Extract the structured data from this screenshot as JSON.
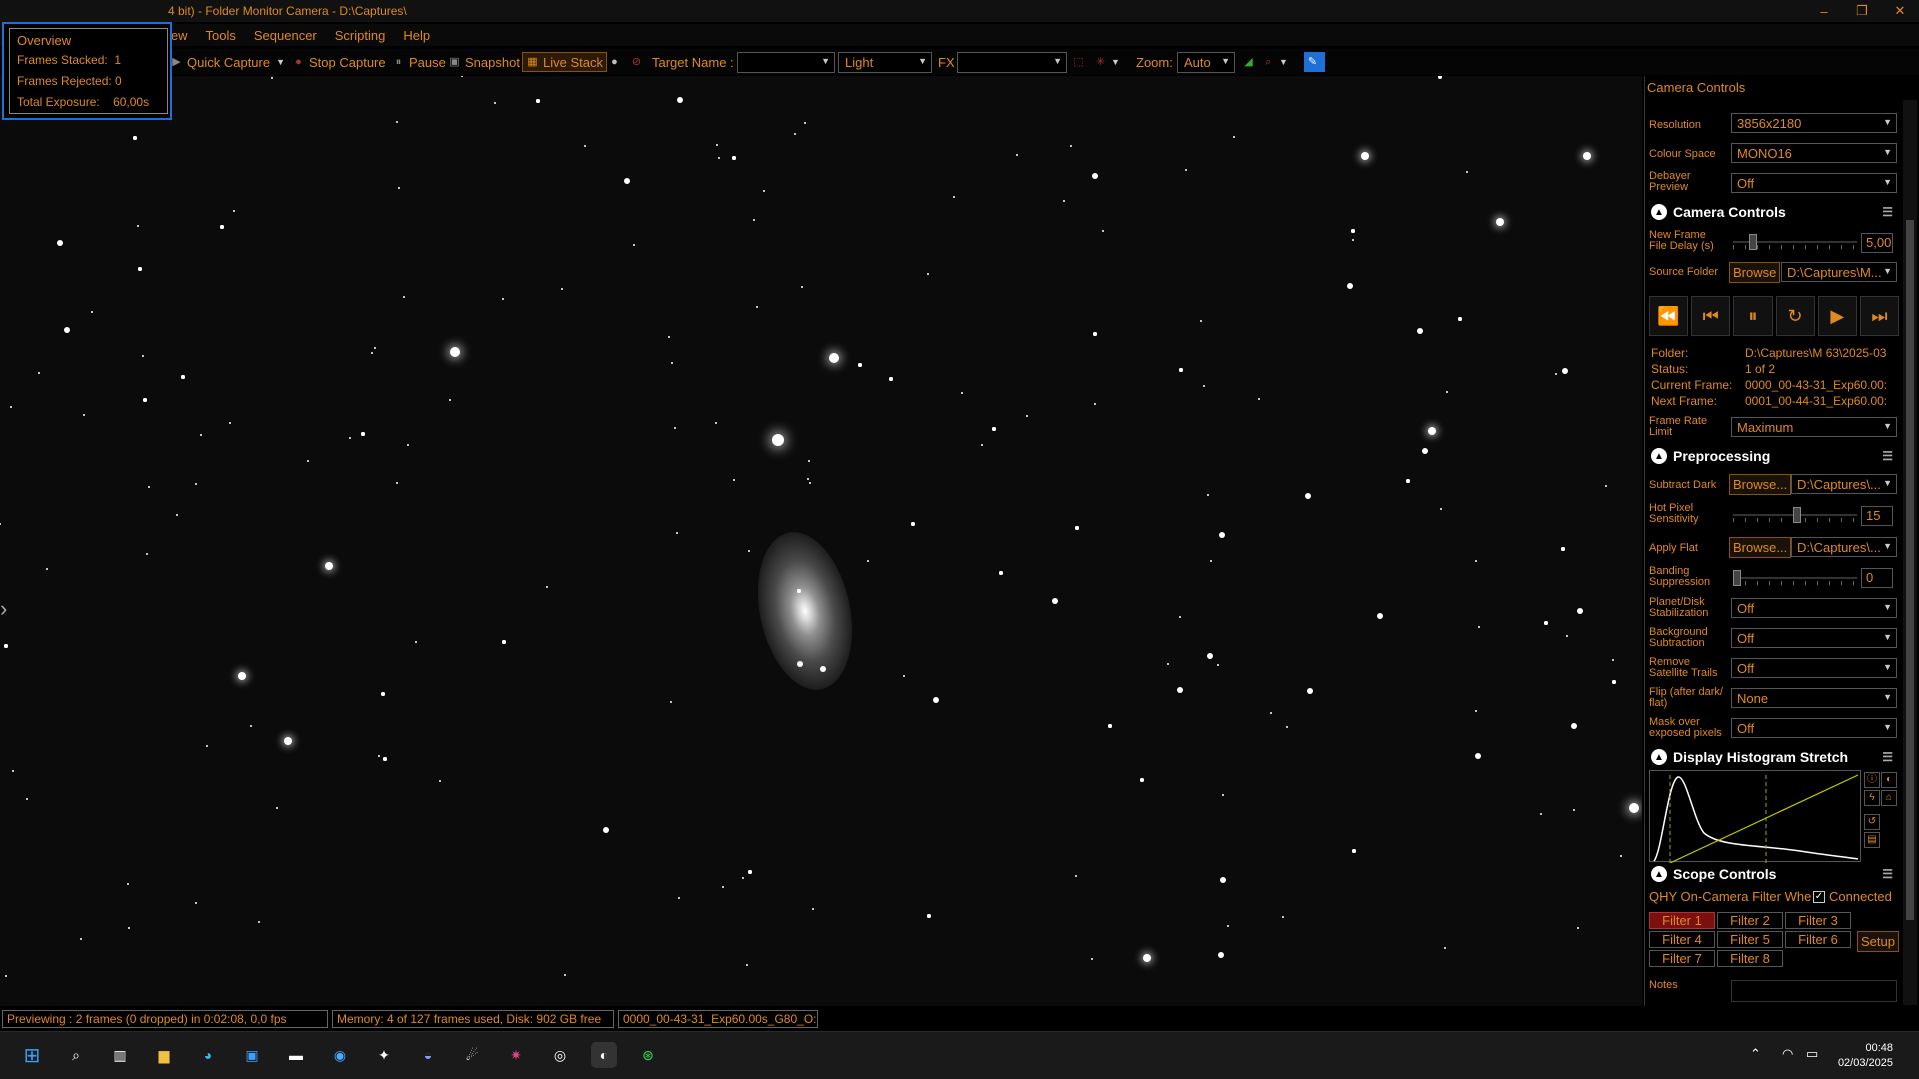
{
  "window": {
    "title": "4 bit) - Folder Monitor Camera - D:\\Captures\\",
    "controls": [
      "–",
      "❐",
      "✕"
    ]
  },
  "menu": [
    "iew",
    "Tools",
    "Sequencer",
    "Scripting",
    "Help"
  ],
  "toolbar": {
    "quick_capture": "Quick Capture",
    "stop_capture": "Stop Capture",
    "pause": "Pause",
    "snapshot": "Snapshot",
    "live_stack": "Live Stack",
    "target_name_label": "Target Name :",
    "target_name_value": "",
    "frame_type": "Light",
    "fx_label": "FX",
    "fx_value": "",
    "zoom_label": "Zoom:",
    "zoom_value": "Auto"
  },
  "overview": {
    "title": "Overview",
    "frames_stacked_label": "Frames Stacked:",
    "frames_stacked": "1",
    "frames_rejected_label": "Frames Rejected:",
    "frames_rejected": "0",
    "total_exposure_label": "Total Exposure:",
    "total_exposure": "60,00s"
  },
  "panel": {
    "header": "Camera Controls",
    "resolution_label": "Resolution",
    "resolution": "3856x2180",
    "colour_space_label": "Colour Space",
    "colour_space": "MONO16",
    "debayer_label": "Debayer Preview",
    "debayer": "Off",
    "camera_controls": {
      "title": "Camera Controls",
      "new_frame_delay_label": "New Frame File Delay (s)",
      "new_frame_delay": "5,00",
      "source_folder_label": "Source Folder",
      "browse": "Browse",
      "source_folder": "D:\\Captures\\M...",
      "folder_label": "Folder:",
      "folder": "D:\\Captures\\M 63\\2025-03",
      "status_label": "Status:",
      "status": "1 of 2",
      "current_frame_label": "Current Frame:",
      "current_frame": "0000_00-43-31_Exp60.00:",
      "next_frame_label": "Next Frame:",
      "next_frame": "0001_00-44-31_Exp60.00:",
      "frame_rate_label": "Frame Rate Limit",
      "frame_rate": "Maximum"
    },
    "preprocessing": {
      "title": "Preprocessing",
      "subtract_dark_label": "Subtract Dark",
      "browse": "Browse...",
      "subtract_dark": "D:\\Captures\\...",
      "hot_pixel_label": "Hot Pixel Sensitivity",
      "hot_pixel": "15",
      "apply_flat_label": "Apply Flat",
      "apply_flat": "D:\\Captures\\...",
      "banding_label": "Banding Suppression",
      "banding": "0",
      "planet_label": "Planet/Disk Stabilization",
      "planet": "Off",
      "background_label": "Background Subtraction",
      "background": "Off",
      "satellite_label": "Remove Satellite Trails",
      "satellite": "Off",
      "flip_label": "Flip (after dark/ flat)",
      "flip": "None",
      "mask_label": "Mask over exposed pixels",
      "mask": "Off"
    },
    "histogram": {
      "title": "Display Histogram Stretch"
    },
    "scope": {
      "title": "Scope Controls",
      "filter_wheel": "QHY On-Camera Filter Whe",
      "connected_label": "Connected",
      "filters": [
        "Filter 1",
        "Filter 2",
        "Filter 3",
        "Filter 4",
        "Filter 5",
        "Filter 6",
        "Filter 7",
        "Filter 8"
      ],
      "selected_filter": "Filter 1",
      "setup": "Setup",
      "notes_label": "Notes"
    }
  },
  "status": {
    "preview": "Previewing : 2 frames (0 dropped) in 0:02:08, 0,0 fps",
    "memory": "Memory: 4 of 127 frames used, Disk: 902 GB free",
    "file": "0000_00-43-31_Exp60.00s_G80_O:"
  },
  "taskbar": {
    "time": "00:48",
    "date": "02/03/2025"
  },
  "colors": {
    "accent": "#e08a1e",
    "overview_border": "#1e6fd8",
    "selected_filter": "#7a1010"
  }
}
